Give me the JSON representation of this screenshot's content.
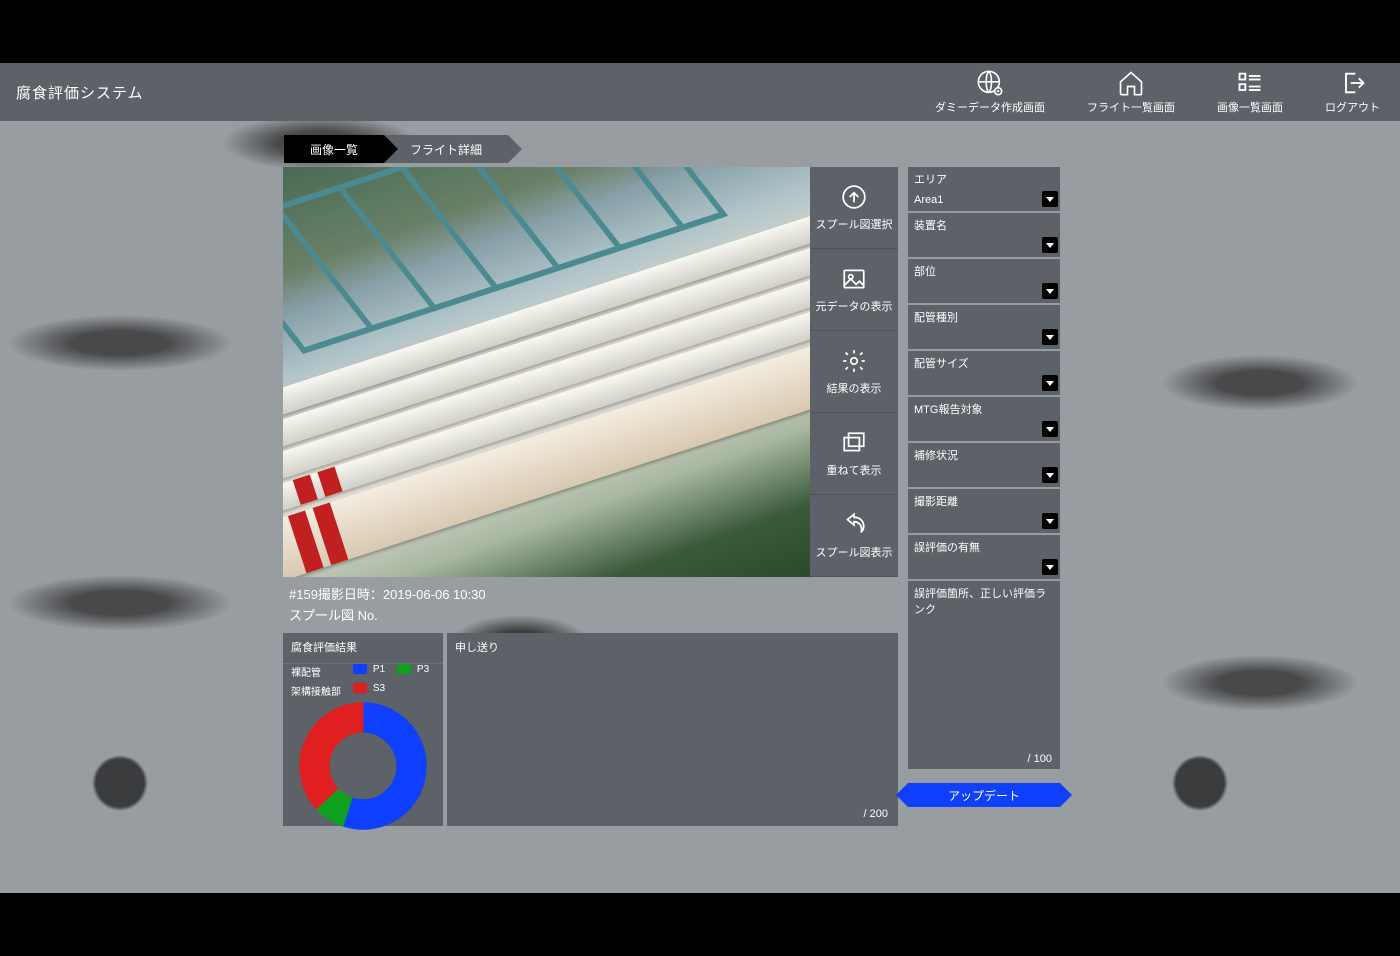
{
  "header": {
    "title": "腐食評価システム",
    "nav": [
      {
        "label": "ダミーデータ作成画面"
      },
      {
        "label": "フライト一覧画面"
      },
      {
        "label": "画像一覧画面"
      },
      {
        "label": "ログアウト"
      }
    ]
  },
  "tabs": {
    "image_list": "画像一覧",
    "flight_detail": "フライト詳細"
  },
  "tools": [
    {
      "label": "スプール図選択"
    },
    {
      "label": "元データの表示"
    },
    {
      "label": "結果の表示"
    },
    {
      "label": "重ねて表示"
    },
    {
      "label": "スプール図表示"
    }
  ],
  "meta": {
    "line1": "#159撮影日時：2019-06-06 10:30",
    "line2": "スプール図 No."
  },
  "result_panel": {
    "title": "腐食評価結果",
    "legend": {
      "row1_label": "裸配管",
      "p1": "P1",
      "p3": "P3",
      "row2_label": "架構接触部",
      "s3": "S3"
    }
  },
  "note_panel": {
    "title": "申し送り",
    "counter": "/ 200"
  },
  "form": {
    "fields": [
      {
        "label": "エリア",
        "value": "Area1"
      },
      {
        "label": "装置名",
        "value": ""
      },
      {
        "label": "部位",
        "value": ""
      },
      {
        "label": "配管種別",
        "value": ""
      },
      {
        "label": "配管サイズ",
        "value": ""
      },
      {
        "label": "MTG報告対象",
        "value": ""
      },
      {
        "label": "補修状況",
        "value": ""
      },
      {
        "label": "撮影距離",
        "value": ""
      },
      {
        "label": "誤評価の有無",
        "value": ""
      }
    ],
    "textarea_label": "誤評価箇所、正しい評価ランク",
    "textarea_counter": "/ 100",
    "update": "アップデート"
  },
  "chart_data": {
    "type": "pie",
    "title": "腐食評価結果",
    "series": [
      {
        "name": "P1",
        "color": "#1040ff",
        "value": 55
      },
      {
        "name": "P3",
        "color": "#10a020",
        "value": 8
      },
      {
        "name": "S3",
        "color": "#e02020",
        "value": 37
      }
    ]
  }
}
